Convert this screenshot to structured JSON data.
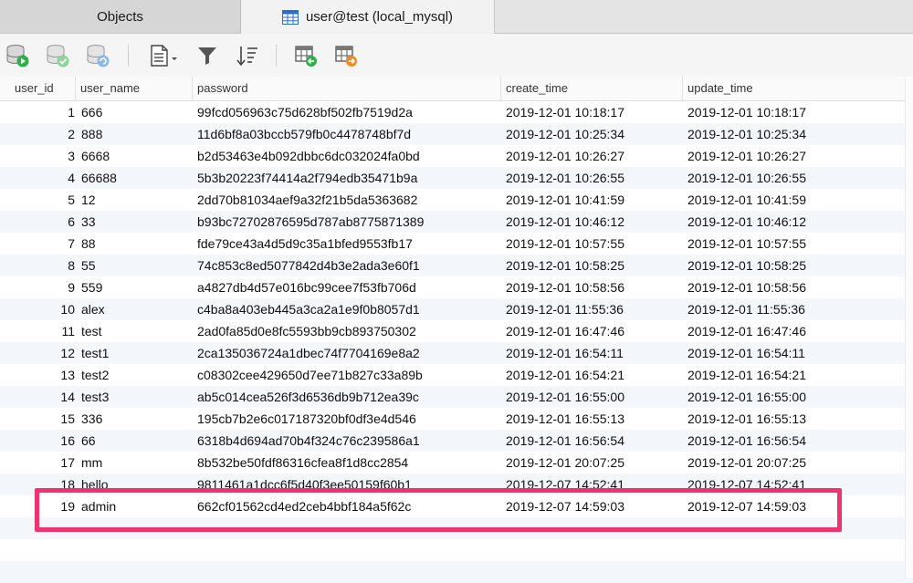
{
  "tabs": [
    {
      "label": "Objects"
    },
    {
      "label": "user@test (local_mysql)"
    }
  ],
  "toolbar": {
    "icons": [
      "db-run-icon",
      "db-check-icon",
      "db-refresh-icon",
      "document-icon",
      "filter-icon",
      "sort-icon",
      "import-icon",
      "export-icon"
    ]
  },
  "grid": {
    "columns": [
      "user_id",
      "user_name",
      "password",
      "create_time",
      "update_time"
    ],
    "rows": [
      [
        "1",
        "666",
        "99fcd056963c75d628bf502fb7519d2a",
        "2019-12-01 10:18:17",
        "2019-12-01 10:18:17"
      ],
      [
        "2",
        "888",
        "11d6bf8a03bccb579fb0c4478748bf7d",
        "2019-12-01 10:25:34",
        "2019-12-01 10:25:34"
      ],
      [
        "3",
        "6668",
        "b2d53463e4b092dbbc6dc032024fa0bd",
        "2019-12-01 10:26:27",
        "2019-12-01 10:26:27"
      ],
      [
        "4",
        "66688",
        "5b3b20223f74414a2f794edb35471b9a",
        "2019-12-01 10:26:55",
        "2019-12-01 10:26:55"
      ],
      [
        "5",
        "12",
        "2dd70b81034aef9a32f21b5da5363682",
        "2019-12-01 10:41:59",
        "2019-12-01 10:41:59"
      ],
      [
        "6",
        "33",
        "b93bc72702876595d787ab8775871389",
        "2019-12-01 10:46:12",
        "2019-12-01 10:46:12"
      ],
      [
        "7",
        "88",
        "fde79ce43a4d5d9c35a1bfed9553fb17",
        "2019-12-01 10:57:55",
        "2019-12-01 10:57:55"
      ],
      [
        "8",
        "55",
        "74c853c8ed5077842d4b3e2ada3e60f1",
        "2019-12-01 10:58:25",
        "2019-12-01 10:58:25"
      ],
      [
        "9",
        "559",
        "a4827db4d57e016bc99cee7f53fb706d",
        "2019-12-01 10:58:56",
        "2019-12-01 10:58:56"
      ],
      [
        "10",
        "alex",
        "c4ba8a403eb445a3ca2a1e9f0b8057d1",
        "2019-12-01 11:55:36",
        "2019-12-01 11:55:36"
      ],
      [
        "11",
        "test",
        "2ad0fa85d0e8fc5593bb9cb893750302",
        "2019-12-01 16:47:46",
        "2019-12-01 16:47:46"
      ],
      [
        "12",
        "test1",
        "2ca135036724a1dbec74f7704169e8a2",
        "2019-12-01 16:54:11",
        "2019-12-01 16:54:11"
      ],
      [
        "13",
        "test2",
        "c08302cee429650d7ee71b827c33a89b",
        "2019-12-01 16:54:21",
        "2019-12-01 16:54:21"
      ],
      [
        "14",
        "test3",
        "ab5c014cea526f3d6536db9b712ea39c",
        "2019-12-01 16:55:00",
        "2019-12-01 16:55:00"
      ],
      [
        "15",
        "336",
        "195cb7b2e6c017187320bf0df3e4d546",
        "2019-12-01 16:55:13",
        "2019-12-01 16:55:13"
      ],
      [
        "16",
        "66",
        "6318b4d694ad70b4f324c76c239586a1",
        "2019-12-01 16:56:54",
        "2019-12-01 16:56:54"
      ],
      [
        "17",
        "mm",
        "8b532be50fdf86316cfea8f1d8cc2854",
        "2019-12-01 20:07:25",
        "2019-12-01 20:07:25"
      ],
      [
        "18",
        "hello",
        "9811461a1dcc6f5d40f3ee50159f60b1",
        "2019-12-07 14:52:41",
        "2019-12-07 14:52:41"
      ],
      [
        "19",
        "admin",
        "662cf01562cd4ed2ceb4bbf184a5f62c",
        "2019-12-07 14:59:03",
        "2019-12-07 14:59:03"
      ]
    ],
    "highlighted_row_index": 18
  },
  "colors": {
    "highlight": "#f0326f",
    "row_alt": "#f3f6fa"
  }
}
